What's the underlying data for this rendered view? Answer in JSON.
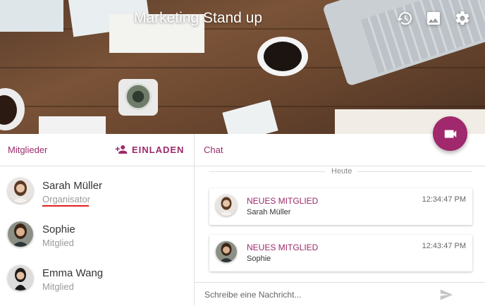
{
  "header": {
    "title": "Marketing Stand up",
    "icons": [
      "history-icon",
      "image-icon",
      "settings-icon"
    ]
  },
  "fab": {
    "icon": "videocam-icon",
    "color": "#a0286d"
  },
  "members": {
    "title": "Mitglieder",
    "invite_label": "EINLADEN",
    "list": [
      {
        "name": "Sarah Müller",
        "role": "Organisator"
      },
      {
        "name": "Sophie",
        "role": "Mitglied"
      },
      {
        "name": "Emma Wang",
        "role": "Mitglied"
      }
    ]
  },
  "chat": {
    "title": "Chat",
    "day_label": "Heute",
    "messages": [
      {
        "type": "NEUES MITGLIED",
        "name": "Sarah Müller",
        "time": "12:34:47 PM"
      },
      {
        "type": "NEUES MITGLIED",
        "name": "Sophie",
        "time": "12:43:47 PM"
      }
    ],
    "input_placeholder": "Schreibe eine Nachricht..."
  },
  "accent": "#9c2a6a"
}
